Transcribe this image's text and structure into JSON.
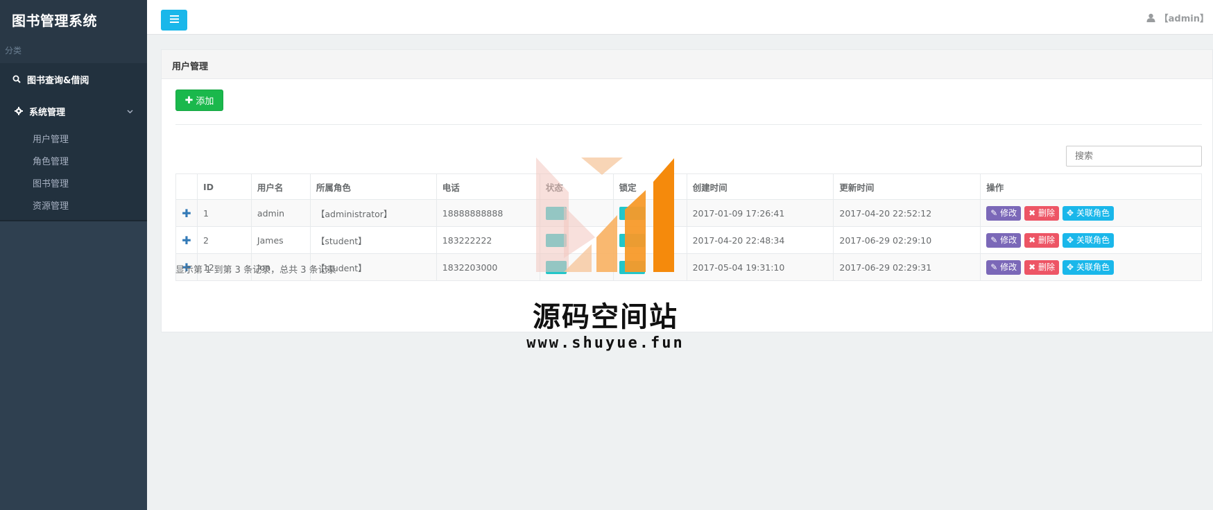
{
  "app": {
    "title": "图书管理系统",
    "category_label": "分类"
  },
  "sidebar": {
    "items": [
      {
        "label": "图书查询&借阅",
        "icon": "search-icon"
      },
      {
        "label": "系统管理",
        "icon": "gear-icon",
        "expanded": true,
        "children": [
          {
            "label": "用户管理"
          },
          {
            "label": "角色管理"
          },
          {
            "label": "图书管理"
          },
          {
            "label": "资源管理"
          }
        ]
      }
    ]
  },
  "topbar": {
    "menu_icon": "bars-icon",
    "user_label": "【admin】",
    "user_icon": "user-icon"
  },
  "panel": {
    "title": "用户管理",
    "add_label": "添加",
    "search_placeholder": "搜索",
    "columns": [
      "",
      "ID",
      "用户名",
      "所属角色",
      "电话",
      "状态",
      "锁定",
      "创建时间",
      "更新时间",
      "操作"
    ],
    "rows": [
      {
        "id": "1",
        "username": "admin",
        "role": "【administrator】",
        "phone": "18888888888",
        "created": "2017-01-09 17:26:41",
        "updated": "2017-04-20 22:52:12"
      },
      {
        "id": "2",
        "username": "James",
        "role": "【student】",
        "phone": "183222222",
        "created": "2017-04-20 22:48:34",
        "updated": "2017-06-29 02:29:10"
      },
      {
        "id": "12",
        "username": "Jon",
        "role": "【student】",
        "phone": "1832203000",
        "created": "2017-05-04 19:31:10",
        "updated": "2017-06-29 02:29:31"
      }
    ],
    "actions": {
      "edit": "修改",
      "delete": "删除",
      "role": "关联角色"
    },
    "footer": "显示第 1 到第 3 条记录，总共 3 条记录"
  },
  "watermark": {
    "title": "源码空间站",
    "url": "www.shuyue.fun"
  },
  "colors": {
    "sidebar": "#2f4050",
    "primary": "#1ab7ea",
    "success": "#1ab84c",
    "danger": "#ed5565",
    "purple": "#7b68b8",
    "info": "#23c6c8"
  }
}
